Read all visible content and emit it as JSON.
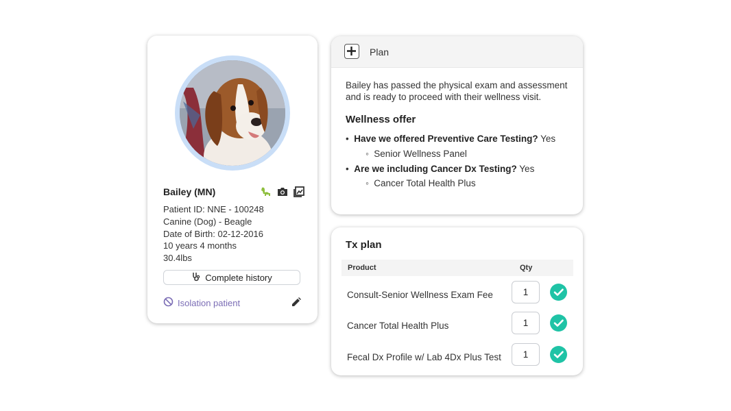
{
  "patient": {
    "name": "Bailey (MN)",
    "patient_id": "Patient ID: NNE - 100248",
    "breed": "Canine (Dog) - Beagle",
    "dob": "Date of Birth: 02-12-2016",
    "age": "10 years 4 months",
    "weight": "30.4lbs",
    "history_button": "Complete history",
    "isolation_label": "Isolation patient",
    "icons": [
      "dog-icon",
      "camera-icon",
      "image-gallery-icon"
    ],
    "accent_color": "#7b6db5",
    "avatar_ring_color": "#c9def7"
  },
  "plan": {
    "title": "Plan",
    "summary": "Bailey has passed the physical exam and assessment and is ready to proceed with their wellness visit.",
    "wellness_heading": "Wellness offer",
    "questions": [
      {
        "question": "Have we offered Preventive Care Testing?",
        "answer": "Yes",
        "item": "Senior Wellness Panel"
      },
      {
        "question": "Are we including Cancer Dx Testing?",
        "answer": "Yes",
        "item": "Cancer Total Health Plus"
      }
    ]
  },
  "tx_plan": {
    "title": "Tx plan",
    "columns": {
      "product": "Product",
      "qty": "Qty"
    },
    "rows": [
      {
        "product": "Consult-Senior Wellness Exam Fee",
        "qty": "1"
      },
      {
        "product": "Cancer Total Health Plus",
        "qty": "1"
      },
      {
        "product": "Fecal Dx Profile w/ Lab 4Dx Plus Test",
        "qty": "1"
      }
    ],
    "check_color": "#1fc3a6"
  }
}
